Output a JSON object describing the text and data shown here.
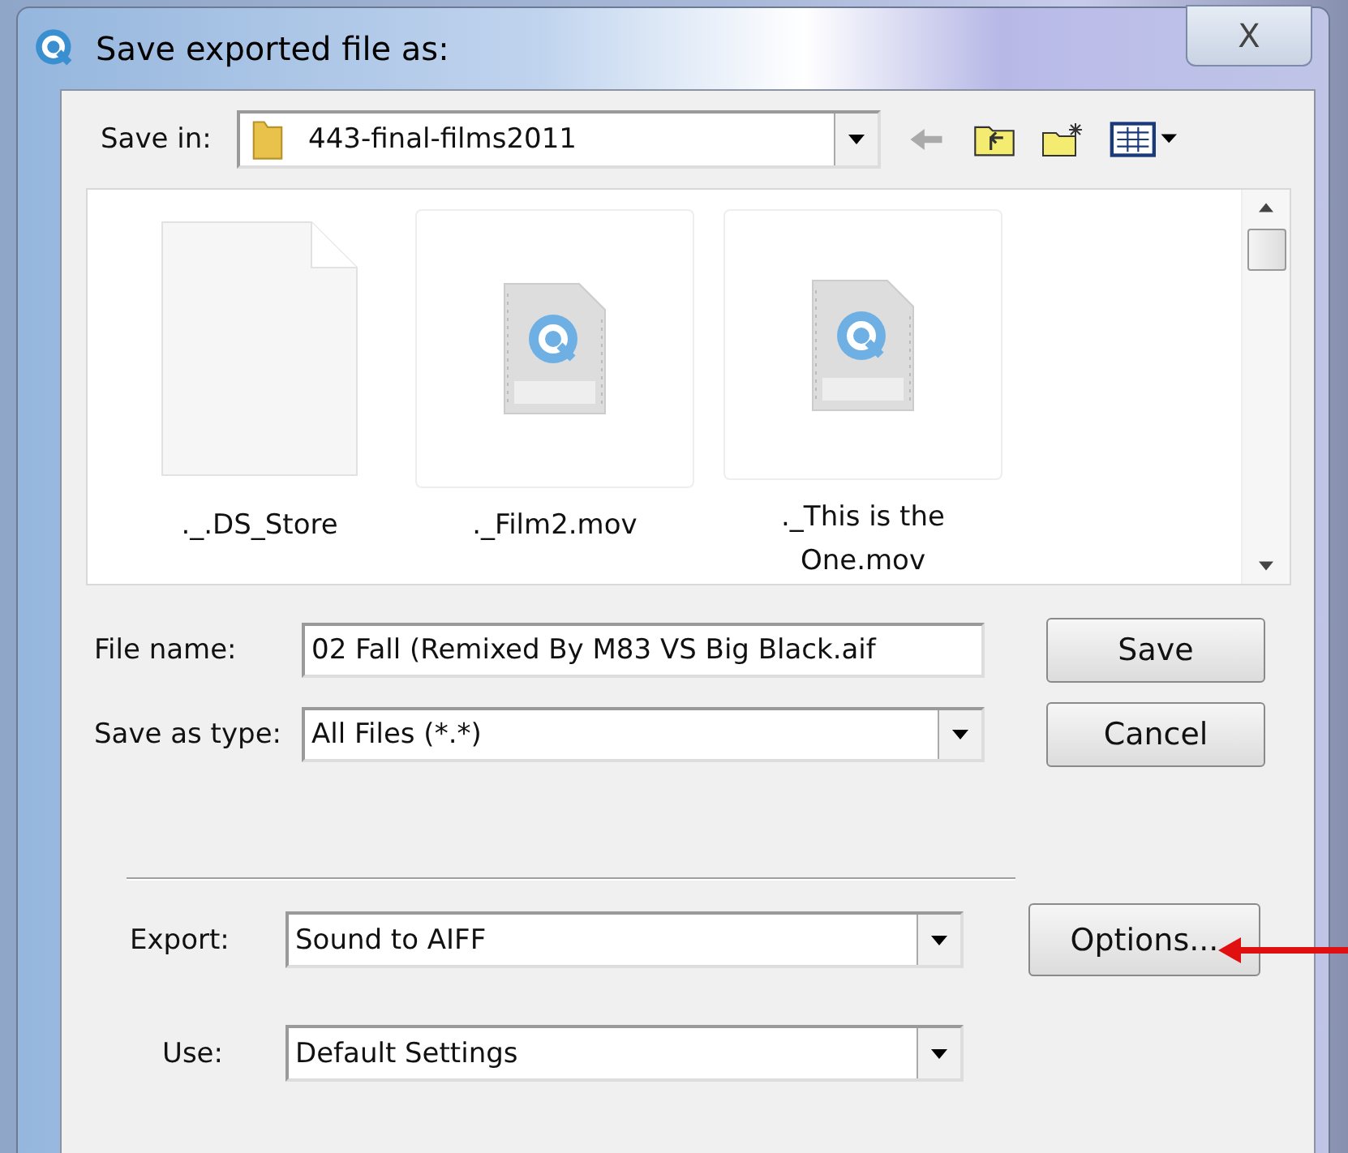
{
  "window": {
    "title": "Save exported file as:",
    "close_label": "X"
  },
  "save_in": {
    "label": "Save in:",
    "value": "443-final-films2011"
  },
  "files": [
    {
      "name": "._.DS_Store",
      "kind": "blank"
    },
    {
      "name": "._Film2.mov",
      "kind": "movie"
    },
    {
      "name": "._This is the One.mov",
      "kind": "movie"
    }
  ],
  "file_name": {
    "label": "File name:",
    "value": "02 Fall (Remixed By M83 VS Big Black.aif"
  },
  "save_as_type": {
    "label": "Save as type:",
    "value": "All Files (*.*)"
  },
  "buttons": [
    "Save",
    "Cancel"
  ],
  "export": {
    "label": "Export:",
    "value": "Sound to AIFF"
  },
  "options_button": "Options...",
  "use": {
    "label": "Use:",
    "value": "Default Settings"
  }
}
